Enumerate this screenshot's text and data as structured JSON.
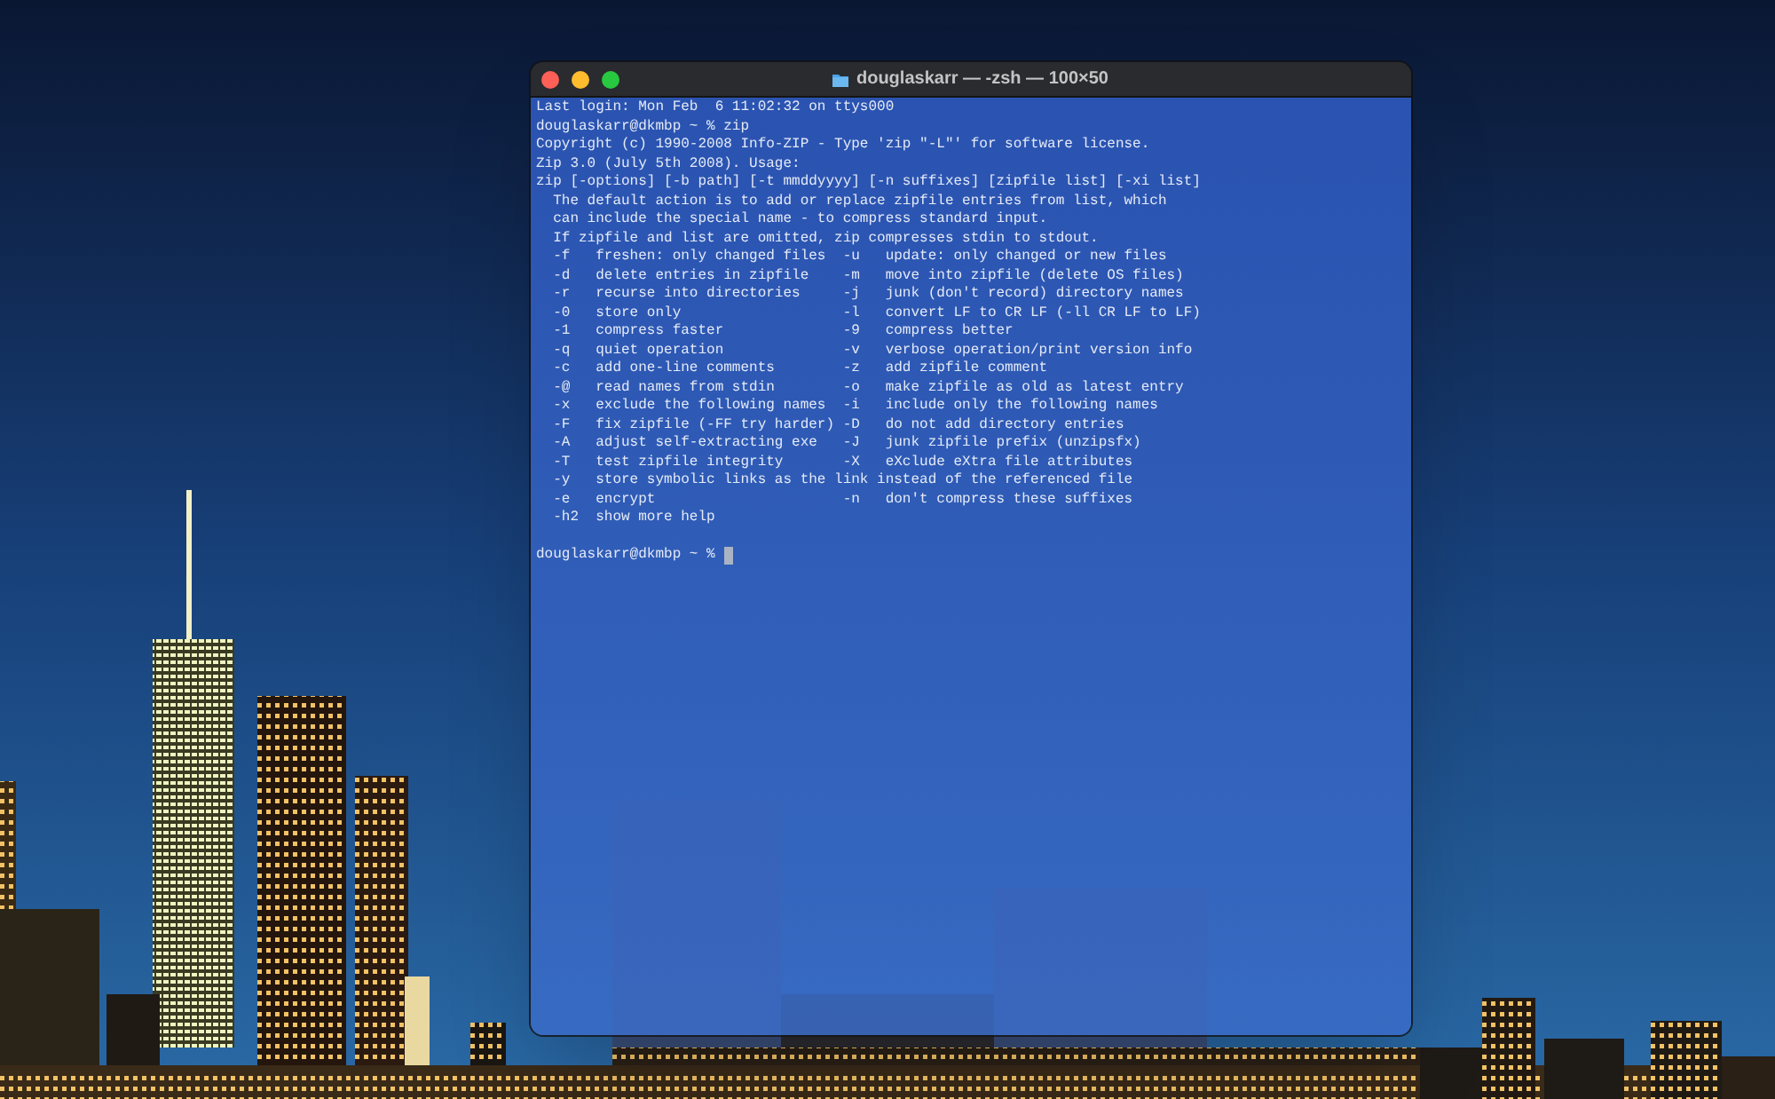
{
  "window": {
    "title": "douglaskarr — -zsh — 100×50"
  },
  "terminal": {
    "lines": [
      "Last login: Mon Feb  6 11:02:32 on ttys000",
      "douglaskarr@dkmbp ~ % zip",
      "Copyright (c) 1990-2008 Info-ZIP - Type 'zip \"-L\"' for software license.",
      "Zip 3.0 (July 5th 2008). Usage:",
      "zip [-options] [-b path] [-t mmddyyyy] [-n suffixes] [zipfile list] [-xi list]",
      "  The default action is to add or replace zipfile entries from list, which",
      "  can include the special name - to compress standard input.",
      "  If zipfile and list are omitted, zip compresses stdin to stdout.",
      "  -f   freshen: only changed files  -u   update: only changed or new files",
      "  -d   delete entries in zipfile    -m   move into zipfile (delete OS files)",
      "  -r   recurse into directories     -j   junk (don't record) directory names",
      "  -0   store only                   -l   convert LF to CR LF (-ll CR LF to LF)",
      "  -1   compress faster              -9   compress better",
      "  -q   quiet operation              -v   verbose operation/print version info",
      "  -c   add one-line comments        -z   add zipfile comment",
      "  -@   read names from stdin        -o   make zipfile as old as latest entry",
      "  -x   exclude the following names  -i   include only the following names",
      "  -F   fix zipfile (-FF try harder) -D   do not add directory entries",
      "  -A   adjust self-extracting exe   -J   junk zipfile prefix (unzipsfx)",
      "  -T   test zipfile integrity       -X   eXclude eXtra file attributes",
      "  -y   store symbolic links as the link instead of the referenced file",
      "  -e   encrypt                      -n   don't compress these suffixes",
      "  -h2  show more help"
    ],
    "prompt": "douglaskarr@dkmbp ~ %"
  }
}
